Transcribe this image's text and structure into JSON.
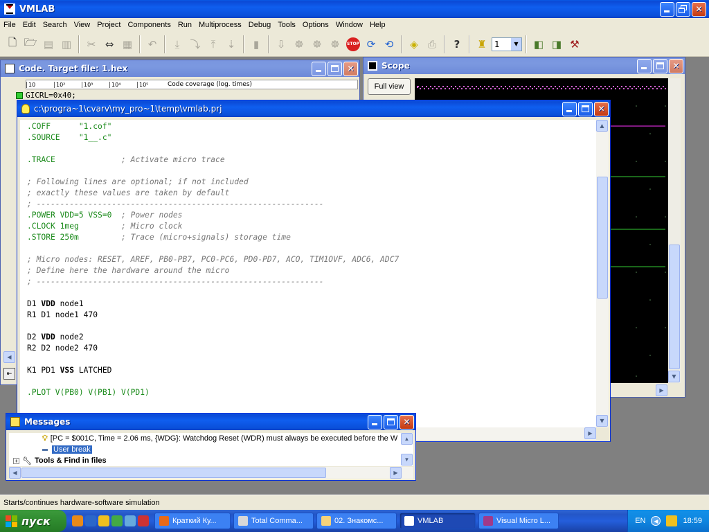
{
  "app": {
    "title": "VMLAB",
    "menu": [
      "File",
      "Edit",
      "Search",
      "View",
      "Project",
      "Components",
      "Run",
      "Multiprocess",
      "Debug",
      "Tools",
      "Options",
      "Window",
      "Help"
    ],
    "cpu_select": "1"
  },
  "toolbar": {
    "icons": [
      "new-icon",
      "open-icon",
      "save-icon",
      "save-all-icon",
      "cut-icon",
      "copy-icon",
      "paste-icon",
      "undo-icon",
      "step-into-icon",
      "step-over-icon",
      "step-out-icon",
      "run-to-cursor-icon",
      "breakpoint-icon",
      "go-icon",
      "go-fast-icon",
      "go-multi-icon",
      "animate-icon",
      "stop-icon",
      "restart-icon",
      "reset-icon",
      "eraser-icon",
      "print-icon",
      "help-icon",
      "multiproc-icon",
      "build-icon",
      "rebuild-icon",
      "make-icon"
    ]
  },
  "code_window": {
    "title": "Code. Target file: 1.hex",
    "ruler": [
      "10",
      "10²",
      "10³",
      "10⁴",
      "10⁵"
    ],
    "coverage_label": "Code coverage (log. times)",
    "visible_line": "GICRL=0x40;"
  },
  "scope_window": {
    "title": "Scope",
    "full_view_label": "Full view"
  },
  "project_window": {
    "title": "c:\\progra~1\\cvarv\\my_pro~1\\temp\\vmlab.prj",
    "lines": [
      [
        {
          "t": ".COFF      ",
          "c": "g"
        },
        {
          "t": "\"1.cof\"",
          "c": "g"
        }
      ],
      [
        {
          "t": ".SOURCE    ",
          "c": "g"
        },
        {
          "t": "\"1__.c\"",
          "c": "g"
        }
      ],
      [],
      [
        {
          "t": ".TRACE              ",
          "c": "g"
        },
        {
          "t": "; Activate micro trace",
          "c": "c"
        }
      ],
      [],
      [
        {
          "t": "; Following lines are optional; if not included",
          "c": "c"
        }
      ],
      [
        {
          "t": "; exactly these values are taken by default",
          "c": "c"
        }
      ],
      [
        {
          "t": "; -------------------------------------------------------------",
          "c": "c"
        }
      ],
      [
        {
          "t": ".POWER VDD=5 VSS=0  ",
          "c": "g"
        },
        {
          "t": "; Power nodes",
          "c": "c"
        }
      ],
      [
        {
          "t": ".CLOCK 1meg         ",
          "c": "g"
        },
        {
          "t": "; Micro clock",
          "c": "c"
        }
      ],
      [
        {
          "t": ".STORE 250m         ",
          "c": "g"
        },
        {
          "t": "; Trace (micro+signals) storage time",
          "c": "c"
        }
      ],
      [],
      [
        {
          "t": "; Micro nodes: RESET, AREF, PB0-PB7, PC0-PC6, PD0-PD7, ACO, TIM1OVF, ADC6, ADC7",
          "c": "c"
        }
      ],
      [
        {
          "t": "; Define here the hardware around the micro",
          "c": "c"
        }
      ],
      [
        {
          "t": "; -------------------------------------------------------------",
          "c": "c"
        }
      ],
      [],
      [
        {
          "t": "D1 ",
          "c": "k"
        },
        {
          "t": "VDD",
          "c": "b"
        },
        {
          "t": " node1",
          "c": "k"
        }
      ],
      [
        {
          "t": "R1 D1 node1 470",
          "c": "k"
        }
      ],
      [],
      [
        {
          "t": "D2 ",
          "c": "k"
        },
        {
          "t": "VDD",
          "c": "b"
        },
        {
          "t": " node2",
          "c": "k"
        }
      ],
      [
        {
          "t": "R2 D2 node2 470",
          "c": "k"
        }
      ],
      [],
      [
        {
          "t": "K1 PD1 ",
          "c": "k"
        },
        {
          "t": "VSS",
          "c": "b"
        },
        {
          "t": " LATCHED",
          "c": "k"
        }
      ],
      [],
      [
        {
          "t": ".PLOT V(PB0) V(PB1) V(PD1)",
          "c": "g"
        }
      ]
    ]
  },
  "messages_window": {
    "title": "Messages",
    "rows": [
      {
        "icon": "bulb-icon",
        "text": "[PC = $001C, Time =    2.06 ms, {WDG}: Watchdog Reset (WDR) must always be executed before the W"
      },
      {
        "icon": "bullet-icon",
        "text": "User break"
      },
      {
        "icon": "wrench-icon",
        "text": "Tools & Find in files"
      }
    ]
  },
  "status_bar": {
    "text": "Starts/continues hardware-software simulation"
  },
  "taskbar": {
    "start_label": "пуск",
    "tasks": [
      "Краткий Ку...",
      "Total Comma...",
      "02. Знакомс...",
      "VMLAB",
      "Visual Micro L..."
    ],
    "lang": "EN",
    "clock": "18:59"
  },
  "colors": {
    "xp_blue": "#0a5ae6",
    "scope_trace_magenta": "#ff33ff",
    "scope_trace_green": "#33cc33"
  }
}
